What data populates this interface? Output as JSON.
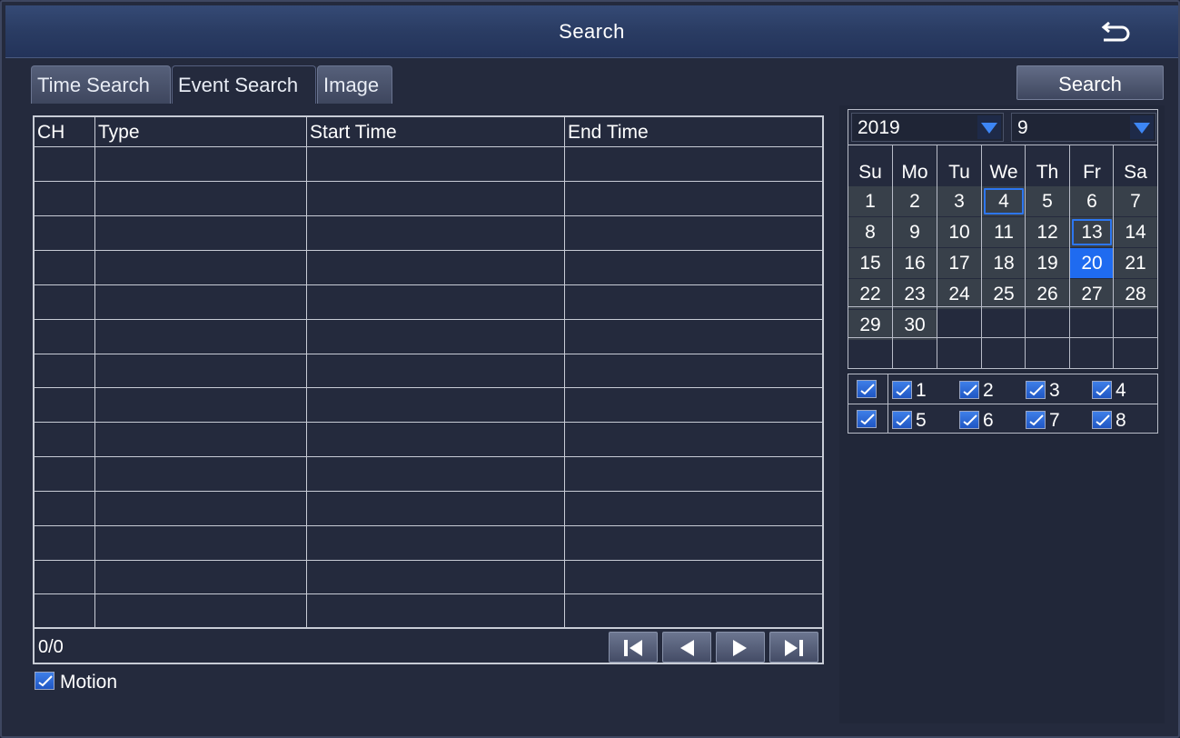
{
  "window": {
    "title": "Search"
  },
  "tabs": [
    {
      "label": "Time Search",
      "active": false
    },
    {
      "label": "Event Search",
      "active": true
    },
    {
      "label": "Image",
      "active": false
    }
  ],
  "search_button": "Search",
  "event_table": {
    "columns": [
      "CH",
      "Type",
      "Start Time",
      "End Time"
    ],
    "rows": [],
    "page_count": "0/0"
  },
  "pager": [
    "first-page-icon",
    "prev-page-icon",
    "next-page-icon",
    "last-page-icon"
  ],
  "motion": {
    "label": "Motion",
    "checked": true
  },
  "calendar": {
    "year": "2019",
    "month": "9",
    "weekdays": [
      "Su",
      "Mo",
      "Tu",
      "We",
      "Th",
      "Fr",
      "Sa"
    ],
    "days": [
      "1",
      "2",
      "3",
      "4",
      "5",
      "6",
      "7",
      "8",
      "9",
      "10",
      "11",
      "12",
      "13",
      "14",
      "15",
      "16",
      "17",
      "18",
      "19",
      "20",
      "21",
      "22",
      "23",
      "24",
      "25",
      "26",
      "27",
      "28",
      "29",
      "30"
    ],
    "marked_days": [
      "4",
      "13"
    ],
    "selected_day": "20"
  },
  "channels": {
    "all_checked": true,
    "items": [
      {
        "label": "1",
        "checked": true
      },
      {
        "label": "2",
        "checked": true
      },
      {
        "label": "3",
        "checked": true
      },
      {
        "label": "4",
        "checked": true
      },
      {
        "label": "5",
        "checked": true
      },
      {
        "label": "6",
        "checked": true
      },
      {
        "label": "7",
        "checked": true
      },
      {
        "label": "8",
        "checked": true
      }
    ]
  },
  "colors": {
    "accent": "#1f6bf0",
    "title_bar": "#2a3c63",
    "background": "#242a3d"
  }
}
